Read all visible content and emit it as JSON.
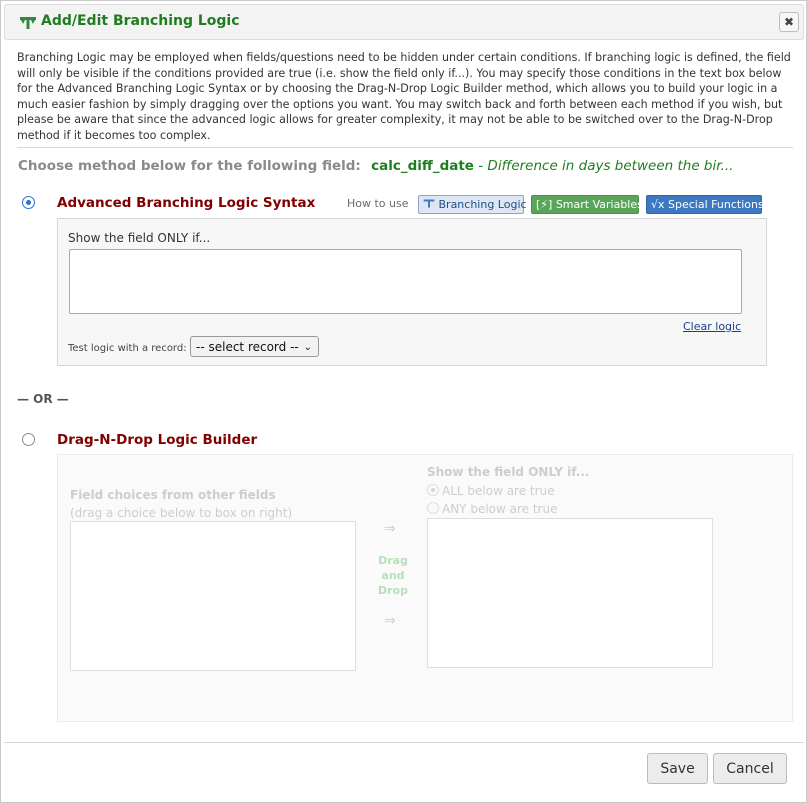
{
  "dialog": {
    "title": "Add/Edit Branching Logic",
    "close_label": "✖",
    "intro": "Branching Logic may be employed when fields/questions need to be hidden under certain conditions. If branching logic is defined, the field will only be visible if the conditions provided are true (i.e. show the field only if...). You may specify those conditions in the text box below for the Advanced Branching Logic Syntax or by choosing the Drag-N-Drop Logic Builder method, which allows you to build your logic in a much easier fashion by simply dragging over the options you want. You may switch back and forth between each method if you wish, but please be aware that since the advanced logic allows for greater complexity, it may not be able to be switched over to the Drag-N-Drop method if it becomes too complex.",
    "choose_label": "Choose method below for the following field:",
    "field_name": "calc_diff_date",
    "field_label": "- Difference in days between the bir..."
  },
  "advanced": {
    "title": "Advanced Branching Logic Syntax",
    "selected": true,
    "how_to_use": "How to use",
    "badges": {
      "branching_logic": "Branching Logic",
      "smart_variables": "Smart Variables",
      "special_functions": "Special Functions"
    },
    "show_field_only_if": "Show the field ONLY if...",
    "logic_value": "",
    "clear_logic": "Clear logic",
    "test_logic_label": "Test logic with a record:",
    "record_select": "-- select record --"
  },
  "or_text": "— OR —",
  "dragndrop": {
    "title": "Drag-N-Drop Logic Builder",
    "selected": false,
    "field_choices_title": "Field choices from other fields",
    "field_choices_hint": "(drag a choice below to box on right)",
    "arrow": "⇒",
    "drag_and_drop": [
      "Drag",
      "and",
      "Drop"
    ],
    "show_field_only_if": "Show the field ONLY if...",
    "all_true": "ALL below are true",
    "any_true": "ANY below are true"
  },
  "footer": {
    "save_label": "Save",
    "cancel_label": "Cancel"
  },
  "colors": {
    "title_green": "#1f7d1f",
    "section_maroon": "#800000",
    "radio_blue": "#2a6fd6",
    "smart_variables_green": "#5ba55b",
    "special_functions_blue": "#3d79c2"
  }
}
